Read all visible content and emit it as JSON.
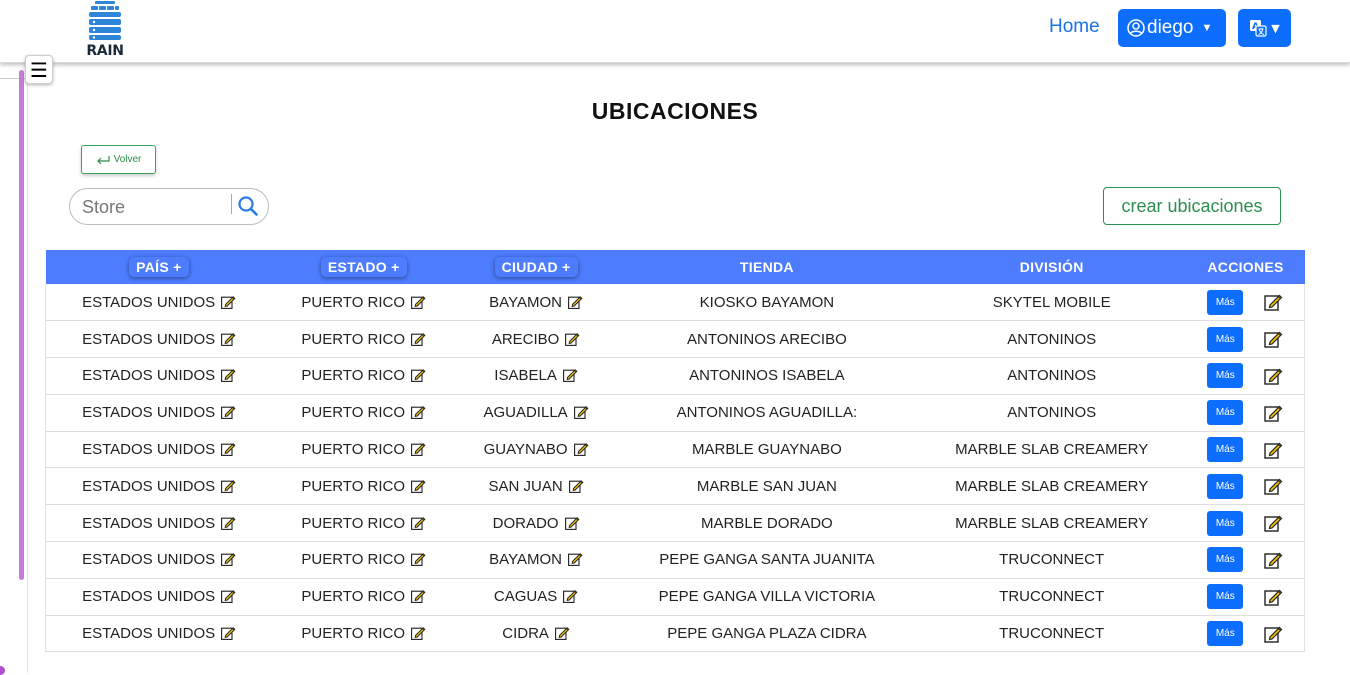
{
  "header": {
    "logo_text": "RAIN",
    "home_label": "Home",
    "user_label": "diego"
  },
  "page": {
    "title": "UBICACIONES",
    "back_label": "Volver",
    "search_placeholder": "Store",
    "create_label": "crear ubicaciones"
  },
  "table": {
    "headers": {
      "pais": "PAÍS +",
      "estado": "ESTADO +",
      "ciudad": "CIUDAD +",
      "tienda": "TIENDA",
      "division": "DIVISIÓN",
      "acciones": "ACCIONES"
    },
    "more_label": "Más",
    "rows": [
      {
        "pais": "ESTADOS UNIDOS",
        "estado": "PUERTO RICO",
        "ciudad": "BAYAMON",
        "tienda": "KIOSKO BAYAMON",
        "division": "SKYTEL MOBILE"
      },
      {
        "pais": "ESTADOS UNIDOS",
        "estado": "PUERTO RICO",
        "ciudad": "ARECIBO",
        "tienda": "ANTONINOS ARECIBO",
        "division": "ANTONINOS"
      },
      {
        "pais": "ESTADOS UNIDOS",
        "estado": "PUERTO RICO",
        "ciudad": "ISABELA",
        "tienda": "ANTONINOS ISABELA",
        "division": "ANTONINOS"
      },
      {
        "pais": "ESTADOS UNIDOS",
        "estado": "PUERTO RICO",
        "ciudad": "AGUADILLA",
        "tienda": "ANTONINOS AGUADILLA:",
        "division": "ANTONINOS"
      },
      {
        "pais": "ESTADOS UNIDOS",
        "estado": "PUERTO RICO",
        "ciudad": "GUAYNABO",
        "tienda": "MARBLE GUAYNABO",
        "division": "MARBLE SLAB CREAMERY"
      },
      {
        "pais": "ESTADOS UNIDOS",
        "estado": "PUERTO RICO",
        "ciudad": "SAN JUAN",
        "tienda": "MARBLE SAN JUAN",
        "division": "MARBLE SLAB CREAMERY"
      },
      {
        "pais": "ESTADOS UNIDOS",
        "estado": "PUERTO RICO",
        "ciudad": "DORADO",
        "tienda": "MARBLE DORADO",
        "division": "MARBLE SLAB CREAMERY"
      },
      {
        "pais": "ESTADOS UNIDOS",
        "estado": "PUERTO RICO",
        "ciudad": "BAYAMON",
        "tienda": "PEPE GANGA SANTA JUANITA",
        "division": "TRUCONNECT"
      },
      {
        "pais": "ESTADOS UNIDOS",
        "estado": "PUERTO RICO",
        "ciudad": "CAGUAS",
        "tienda": "PEPE GANGA VILLA VICTORIA",
        "division": "TRUCONNECT"
      },
      {
        "pais": "ESTADOS UNIDOS",
        "estado": "PUERTO RICO",
        "ciudad": "CIDRA",
        "tienda": "PEPE GANGA PLAZA CIDRA",
        "division": "TRUCONNECT"
      }
    ]
  },
  "colors": {
    "primary": "#0d6efd",
    "table_header": "#4d7cfe",
    "success": "#2c8f4f",
    "sidebar_accent": "#c47dd6"
  },
  "icons": {
    "logo": "database-icon",
    "user": "user-circle-icon",
    "language": "translate-icon",
    "menu": "hamburger-icon",
    "back": "return-arrow-icon",
    "search": "search-icon",
    "edit": "edit-pencil-icon"
  }
}
